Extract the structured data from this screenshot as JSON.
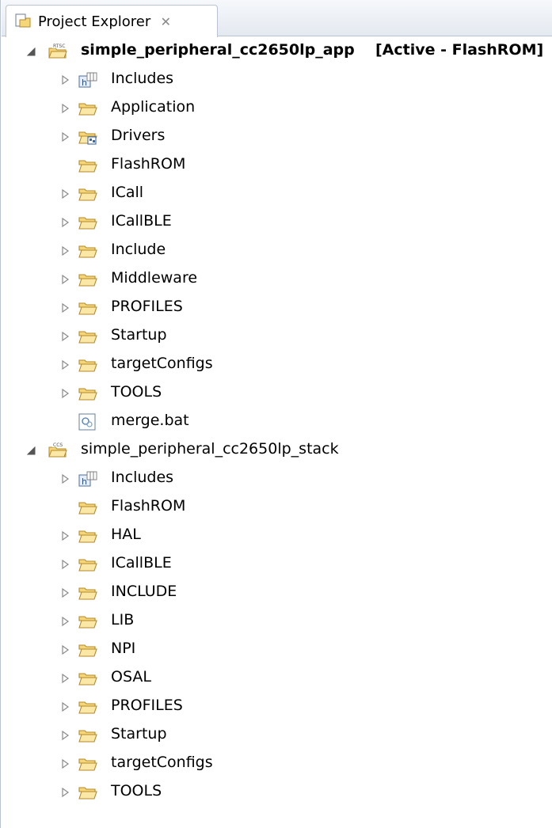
{
  "tab": {
    "label": "Project Explorer",
    "close_symbol": "✕"
  },
  "projects": [
    {
      "name": "simple_peripheral_cc2650lp_app",
      "status": "[Active - FlashROM]",
      "badge": "RTSC",
      "expanded": true,
      "bold": true,
      "children": [
        {
          "label": "Includes",
          "type": "includes",
          "expandable": true
        },
        {
          "label": "Application",
          "type": "folder",
          "expandable": true
        },
        {
          "label": "Drivers",
          "type": "linked-folder",
          "expandable": true
        },
        {
          "label": "FlashROM",
          "type": "folder",
          "expandable": false
        },
        {
          "label": "ICall",
          "type": "folder",
          "expandable": true
        },
        {
          "label": "ICallBLE",
          "type": "folder",
          "expandable": true
        },
        {
          "label": "Include",
          "type": "folder",
          "expandable": true
        },
        {
          "label": "Middleware",
          "type": "folder",
          "expandable": true
        },
        {
          "label": "PROFILES",
          "type": "folder",
          "expandable": true
        },
        {
          "label": "Startup",
          "type": "folder",
          "expandable": true
        },
        {
          "label": "targetConfigs",
          "type": "folder",
          "expandable": true
        },
        {
          "label": "TOOLS",
          "type": "folder",
          "expandable": true
        },
        {
          "label": "merge.bat",
          "type": "file",
          "expandable": false
        }
      ]
    },
    {
      "name": "simple_peripheral_cc2650lp_stack",
      "status": "",
      "badge": "CCS",
      "expanded": true,
      "bold": false,
      "children": [
        {
          "label": "Includes",
          "type": "includes",
          "expandable": true
        },
        {
          "label": "FlashROM",
          "type": "folder",
          "expandable": false
        },
        {
          "label": "HAL",
          "type": "folder",
          "expandable": true
        },
        {
          "label": "ICallBLE",
          "type": "folder",
          "expandable": true
        },
        {
          "label": "INCLUDE",
          "type": "folder",
          "expandable": true
        },
        {
          "label": "LIB",
          "type": "folder",
          "expandable": true
        },
        {
          "label": "NPI",
          "type": "folder",
          "expandable": true
        },
        {
          "label": "OSAL",
          "type": "folder",
          "expandable": true
        },
        {
          "label": "PROFILES",
          "type": "folder",
          "expandable": true
        },
        {
          "label": "Startup",
          "type": "folder",
          "expandable": true
        },
        {
          "label": "targetConfigs",
          "type": "folder",
          "expandable": true
        },
        {
          "label": "TOOLS",
          "type": "folder",
          "expandable": true
        }
      ]
    }
  ],
  "colors": {
    "folder_fill": "#f5d77a",
    "folder_stroke": "#b48a2a",
    "twisty": "#8a8a8a",
    "tab_border": "#b9c3d1"
  }
}
